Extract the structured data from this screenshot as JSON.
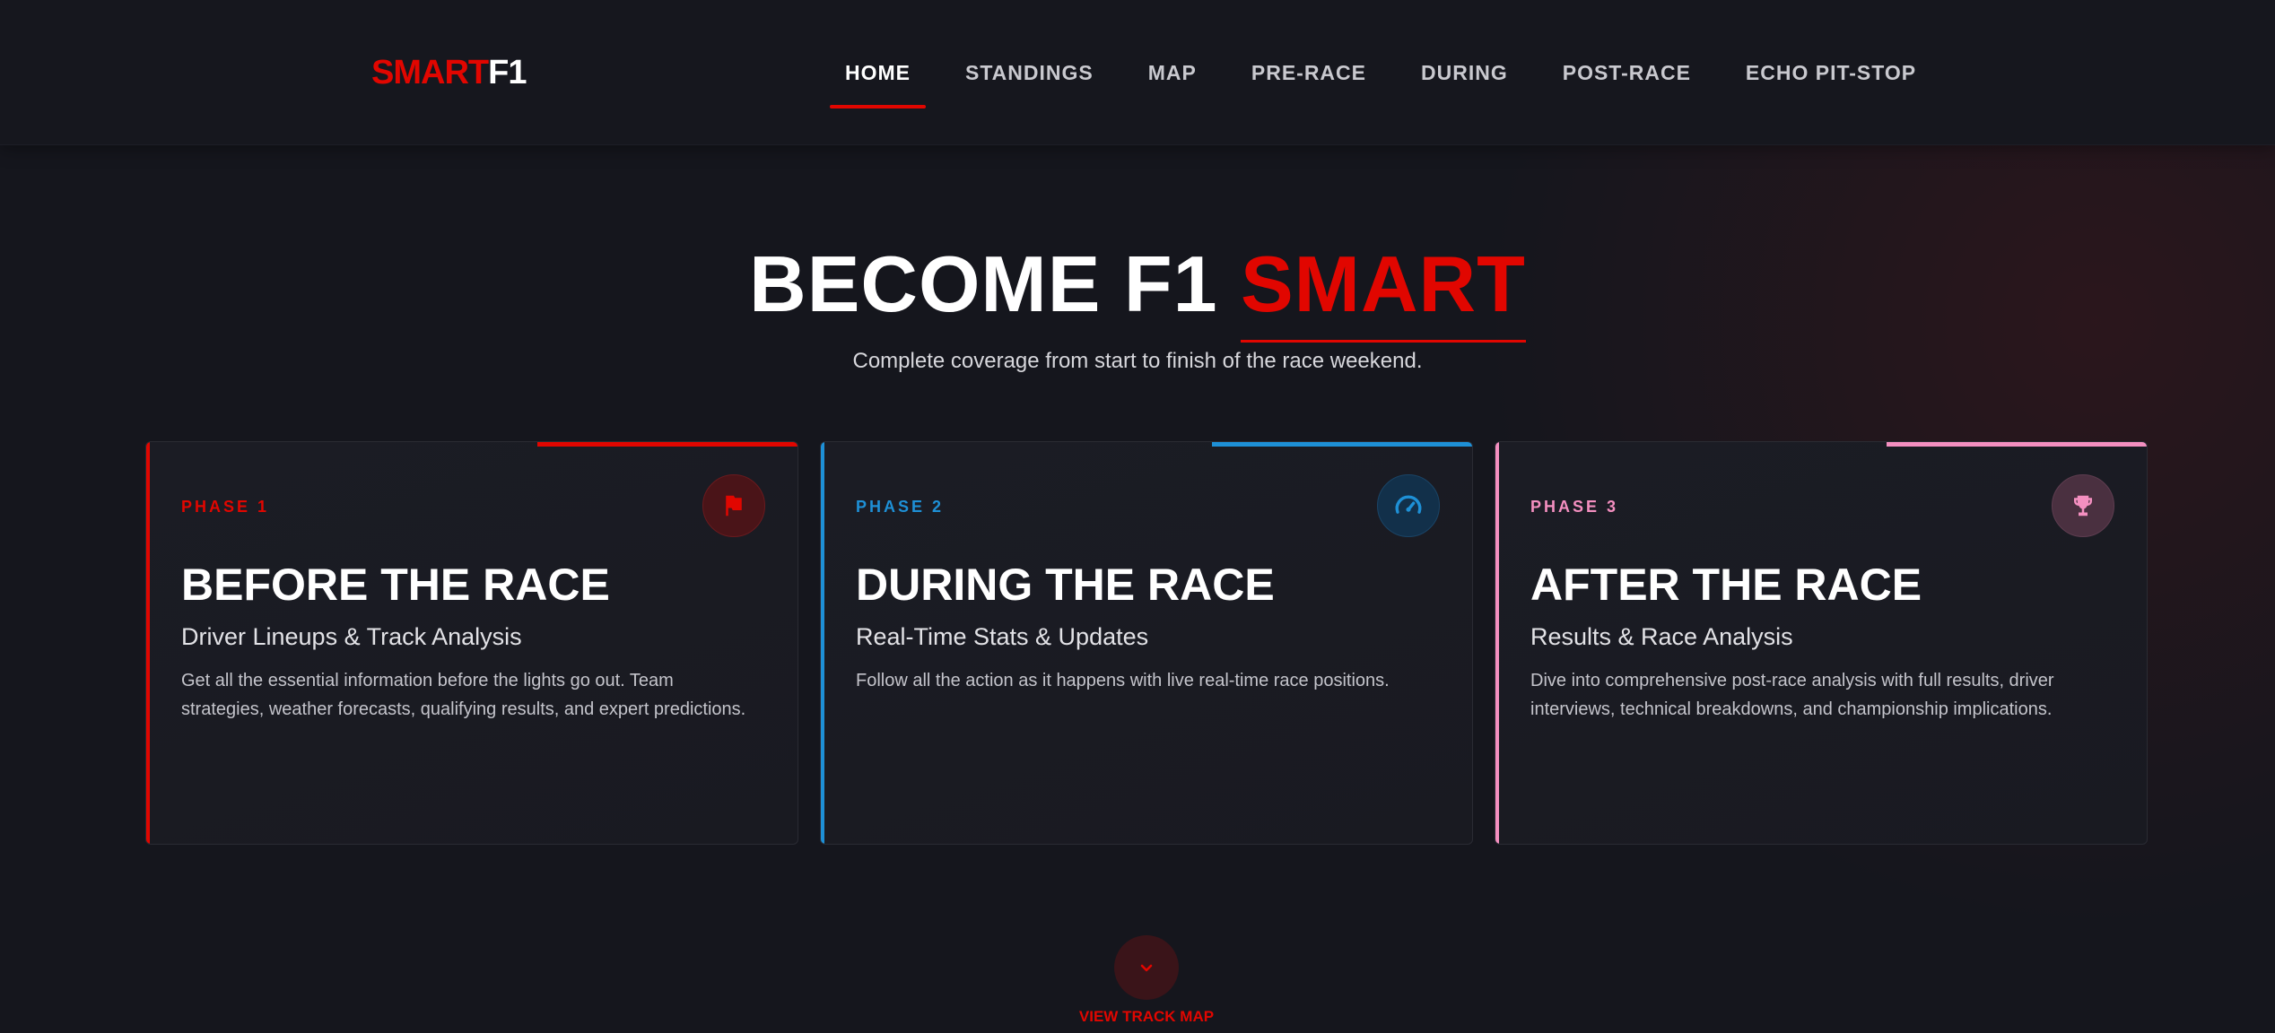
{
  "brand": {
    "part1": "SMART",
    "part2": "F1"
  },
  "nav": {
    "items": [
      "HOME",
      "STANDINGS",
      "MAP",
      "PRE-RACE",
      "DURING",
      "POST-RACE",
      "ECHO PIT-STOP"
    ],
    "active": "HOME"
  },
  "hero": {
    "title_white": "BECOME F1",
    "title_red": "SMART",
    "subtitle": "Complete coverage from start to finish of the race weekend."
  },
  "cards": [
    {
      "phase": "PHASE 1",
      "title": "BEFORE THE RACE",
      "subtitle": "Driver Lineups & Track Analysis",
      "description": "Get all the essential information before the lights go out. Team strategies, weather forecasts, qualifying results, and expert predictions.",
      "icon": "flag-icon",
      "accent": "#e10600"
    },
    {
      "phase": "PHASE 2",
      "title": "DURING THE RACE",
      "subtitle": "Real-Time Stats & Updates",
      "description": "Follow all the action as it happens with live real-time race positions.",
      "icon": "speedometer-icon",
      "accent": "#1e90d6"
    },
    {
      "phase": "PHASE 3",
      "title": "AFTER THE RACE",
      "subtitle": "Results & Race Analysis",
      "description": "Dive into comprehensive post-race analysis with full results, driver interviews, technical breakdowns, and championship implications.",
      "icon": "trophy-icon",
      "accent": "#f48fc0"
    }
  ],
  "cta": {
    "label": "VIEW TRACK MAP",
    "icon": "chevron-down-icon"
  },
  "colors": {
    "primary": "#e10600",
    "background": "#15161d"
  }
}
